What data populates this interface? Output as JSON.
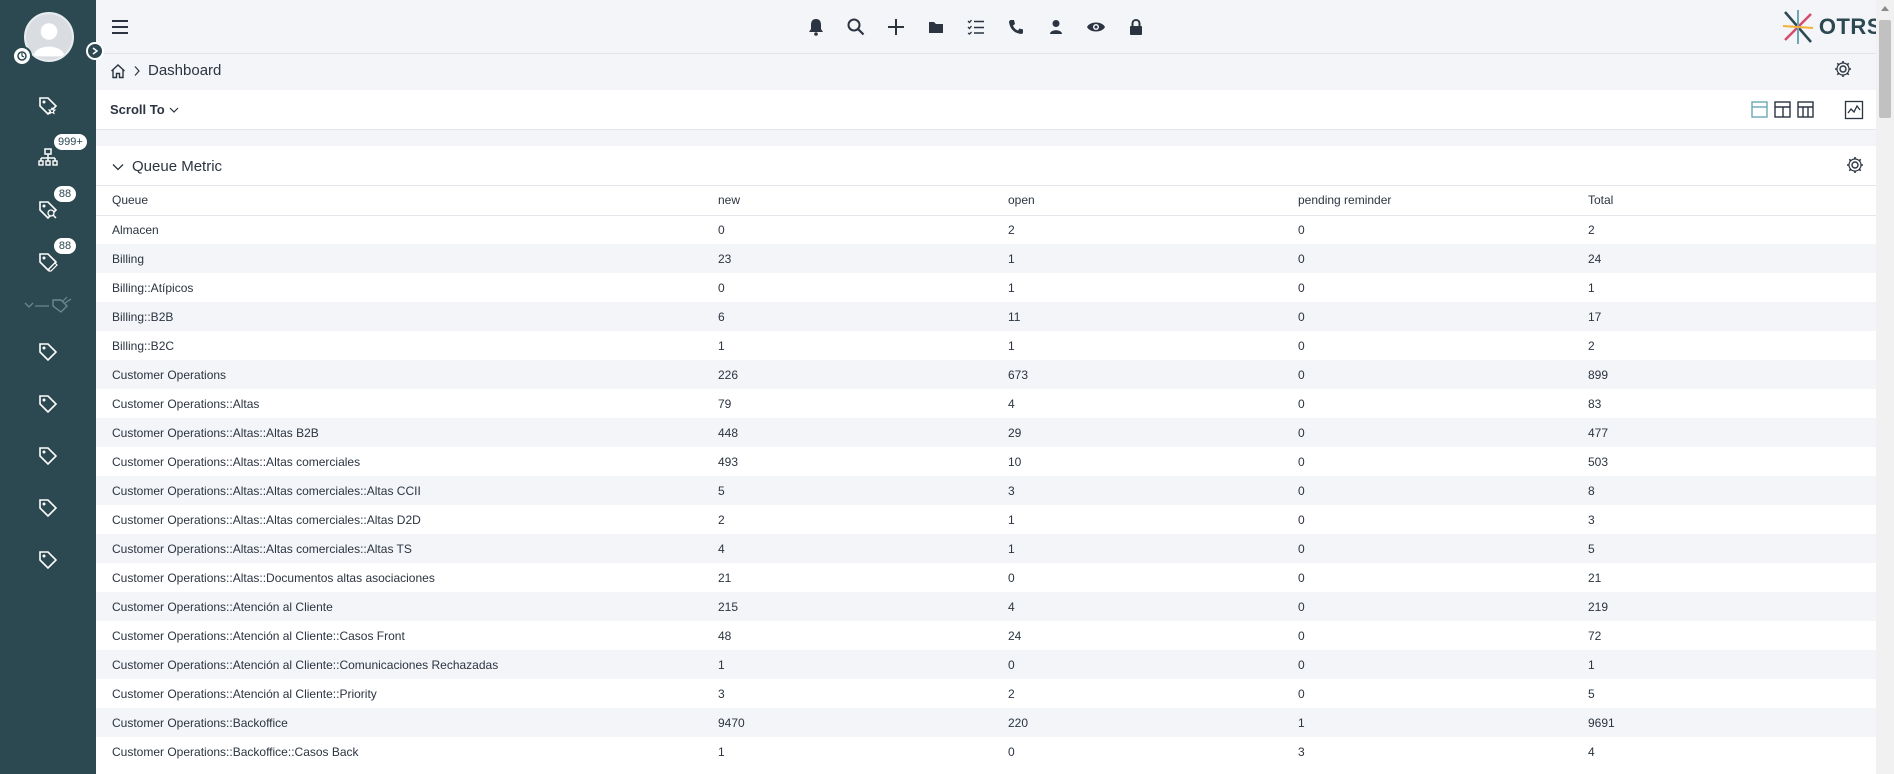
{
  "sidebar": {
    "items": [
      {
        "icon": "tag-star-icon",
        "badge": ""
      },
      {
        "icon": "sitemap-icon",
        "badge": "999+"
      },
      {
        "icon": "tag-search-icon",
        "badge": "88"
      },
      {
        "icon": "tag-edit-icon",
        "badge": "88"
      },
      {
        "icon": "tag-icon",
        "badge": ""
      },
      {
        "icon": "tag-icon",
        "badge": ""
      },
      {
        "icon": "tag-icon",
        "badge": ""
      },
      {
        "icon": "tag-icon",
        "badge": ""
      },
      {
        "icon": "tag-icon",
        "badge": ""
      }
    ]
  },
  "topbar": {
    "icons": [
      "bell-icon",
      "search-icon",
      "plus-icon",
      "folder-icon",
      "list-icon",
      "phone-icon",
      "user-icon",
      "eye-icon",
      "lock-icon"
    ],
    "logo_text": "OTRS"
  },
  "breadcrumb": {
    "current": "Dashboard"
  },
  "toolbar": {
    "scroll_to": "Scroll To"
  },
  "widget": {
    "title": "Queue Metric",
    "columns": [
      "Queue",
      "new",
      "open",
      "pending reminder",
      "Total"
    ],
    "rows": [
      [
        "Almacen",
        "0",
        "2",
        "0",
        "2"
      ],
      [
        "Billing",
        "23",
        "1",
        "0",
        "24"
      ],
      [
        "Billing::Atípicos",
        "0",
        "1",
        "0",
        "1"
      ],
      [
        "Billing::B2B",
        "6",
        "11",
        "0",
        "17"
      ],
      [
        "Billing::B2C",
        "1",
        "1",
        "0",
        "2"
      ],
      [
        "Customer Operations",
        "226",
        "673",
        "0",
        "899"
      ],
      [
        "Customer Operations::Altas",
        "79",
        "4",
        "0",
        "83"
      ],
      [
        "Customer Operations::Altas::Altas B2B",
        "448",
        "29",
        "0",
        "477"
      ],
      [
        "Customer Operations::Altas::Altas comerciales",
        "493",
        "10",
        "0",
        "503"
      ],
      [
        "Customer Operations::Altas::Altas comerciales::Altas CCII",
        "5",
        "3",
        "0",
        "8"
      ],
      [
        "Customer Operations::Altas::Altas comerciales::Altas D2D",
        "2",
        "1",
        "0",
        "3"
      ],
      [
        "Customer Operations::Altas::Altas comerciales::Altas TS",
        "4",
        "1",
        "0",
        "5"
      ],
      [
        "Customer Operations::Altas::Documentos altas asociaciones",
        "21",
        "0",
        "0",
        "21"
      ],
      [
        "Customer Operations::Atención al Cliente",
        "215",
        "4",
        "0",
        "219"
      ],
      [
        "Customer Operations::Atención al Cliente::Casos Front",
        "48",
        "24",
        "0",
        "72"
      ],
      [
        "Customer Operations::Atención al Cliente::Comunicaciones Rechazadas",
        "1",
        "0",
        "0",
        "1"
      ],
      [
        "Customer Operations::Atención al Cliente::Priority",
        "3",
        "2",
        "0",
        "5"
      ],
      [
        "Customer Operations::Backoffice",
        "9470",
        "220",
        "1",
        "9691"
      ],
      [
        "Customer Operations::Backoffice::Casos Back",
        "1",
        "0",
        "3",
        "4"
      ]
    ]
  }
}
